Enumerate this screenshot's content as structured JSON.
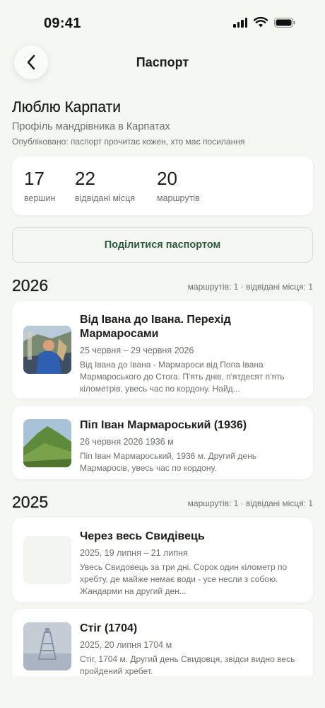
{
  "status": {
    "time": "09:41"
  },
  "header": {
    "title": "Паспорт"
  },
  "profile": {
    "name": "Люблю Карпати",
    "subtitle": "Профіль мандрівника в Карпатах",
    "published": "Опубліковано: паспорт прочитає кожен, хто має посилання"
  },
  "stats": [
    {
      "value": "17",
      "label": "вершин"
    },
    {
      "value": "22",
      "label": "відвідані місця"
    },
    {
      "value": "20",
      "label": "маршрутів"
    }
  ],
  "share_label": "Поділитися паспортом",
  "years": [
    {
      "year": "2026",
      "meta": "маршрутів: 1 · відвідані місця: 1",
      "entries": [
        {
          "title": "Від Івана до Івана. Перехід Мармаросами",
          "date": "25 червня – 29 червня 2026",
          "desc": "Від Івана до Івана - Мармароси від Попа Івана Мармароського до Стога. П'ять днів, п'ятдесят п'ять кілометрів, увесь час по кордону. Найд...",
          "thumb": "hiker-photo"
        },
        {
          "title": "Піп Іван Мармароський (1936)",
          "date": "26 червня 2026   1936 м",
          "desc": "Піп Іван Мармароський, 1936 м. Другий день Мармаросів, увесь час по кордону.",
          "thumb": "mountain-photo"
        }
      ]
    },
    {
      "year": "2025",
      "meta": "маршрутів: 1 · відвідані місця: 1",
      "entries": [
        {
          "title": "Через весь Свидівець",
          "date": "2025, 19 липня – 21 липня",
          "desc": "Увесь Свидовець за три дні. Сорок один кілометр по хребту, де майже немає води - усе несли з собою. Жандарми на другий ден...",
          "thumb": "empty"
        },
        {
          "title": "Стіг (1704)",
          "date": "2025, 20 липня   1704 м",
          "desc": "Стіг, 1704 м. Другий день Свидовця, звідси видно весь пройдений хребет.",
          "thumb": "foggy-summit-photo"
        }
      ]
    }
  ],
  "colors": {
    "background": "#f4f7f2",
    "card": "#ffffff",
    "accent_green": "#2c5a3c",
    "muted_text": "#6c726a"
  },
  "icons": {
    "back": "chevron-left-icon",
    "signal": "signal-icon",
    "wifi": "wifi-icon",
    "battery": "battery-icon"
  }
}
